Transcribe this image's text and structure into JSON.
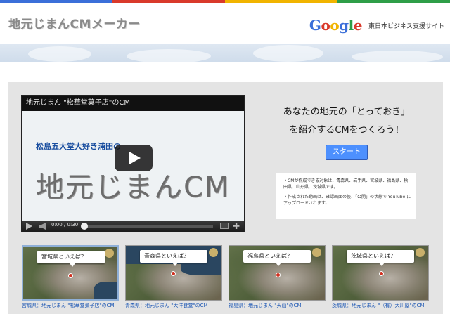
{
  "header": {
    "site_title": "地元じまんCMメーカー",
    "brand_logo_letters": [
      "G",
      "o",
      "o",
      "g",
      "l",
      "e"
    ],
    "brand_logo_colors": [
      "#3b6fd9",
      "#d93a2b",
      "#f1b400",
      "#3b6fd9",
      "#2e9e48",
      "#d93a2b"
    ],
    "brand_tagline": "東日本ビジネス支援サイト",
    "topbar_colors": [
      "#3b6fd9",
      "#d93a2b",
      "#f1b400",
      "#2e9e48"
    ]
  },
  "player": {
    "title": "地元じまん \"松華堂菓子店\"のCM",
    "frame_subtitle": "松島五大堂大好き浦田の",
    "frame_main": "地元じまんCM",
    "time": "0:00 / 0:30"
  },
  "promo": {
    "line1": "あなたの地元の「とっておき」",
    "line2": "を紹介するCMをつくろう！",
    "start_label": "スタート",
    "accent": "#4d90fe",
    "notes": [
      "・CMが作成できる対象は、青森県、岩手県、宮城県、福島県、秋田県、山形県、茨城県です。",
      "・作成された動画は、確認画面の後、「公開」の状態で YouTube にアップロードされます。"
    ]
  },
  "examples": [
    {
      "callout": "宮城県といえば？",
      "caption": "宮城県：地元じまん \"松華堂菓子店\"のCM",
      "active": true
    },
    {
      "callout": "青森県といえば？",
      "caption": "青森県：地元じまん \"大洋食堂\"のCM",
      "active": false
    },
    {
      "callout": "福島県といえば？",
      "caption": "福島県：地元じまん \"天山\"のCM",
      "active": false
    },
    {
      "callout": "茨城県といえば？",
      "caption": "茨城県：地元じまん \"（有）大川屋\"のCM",
      "active": false
    }
  ]
}
